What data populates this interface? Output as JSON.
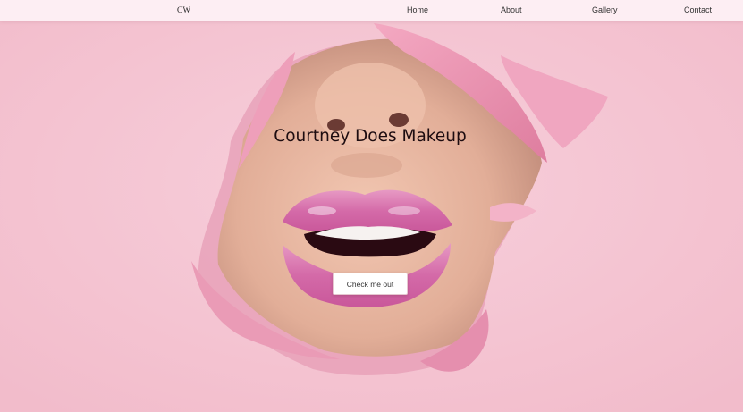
{
  "nav": {
    "brand": "CW",
    "links": [
      "Home",
      "About",
      "Gallery",
      "Contact"
    ]
  },
  "hero": {
    "title": "Courtney Does Makeup",
    "cta_label": "Check me out",
    "image_subject": "lips-through-torn-paper",
    "colors": {
      "background": "#f4c4d2",
      "paper_edge": "#e793b0",
      "skin": "#e4b4a0",
      "lips": "#d86aa9",
      "navbar": "#fdeef3"
    }
  }
}
